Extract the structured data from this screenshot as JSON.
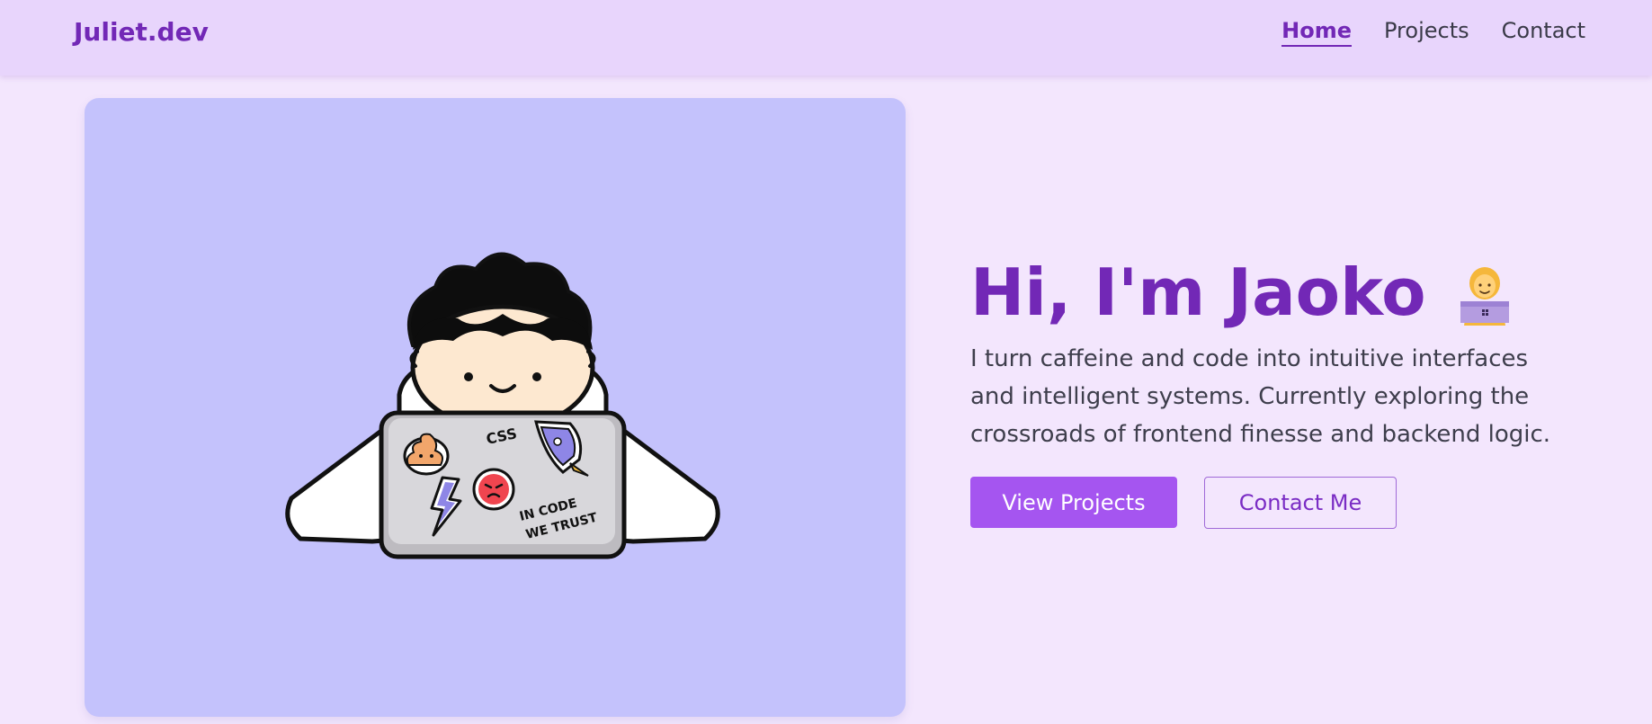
{
  "nav": {
    "brand": "Juliet.dev",
    "links": [
      {
        "label": "Home",
        "active": true
      },
      {
        "label": "Projects",
        "active": false
      },
      {
        "label": "Contact",
        "active": false
      }
    ]
  },
  "hero": {
    "headline": "Hi, I'm Jaoko",
    "headline_emoji": "woman-technologist-icon",
    "intro": "I turn caffeine and code into intuitive interfaces and intelligent systems. Currently exploring the crossroads of frontend finesse and backend logic.",
    "primary_button": "View Projects",
    "secondary_button": "Contact Me"
  },
  "illustration": {
    "stickers": {
      "css": "CSS",
      "motto_line1": "IN CODE",
      "motto_line2": "WE TRUST"
    }
  },
  "colors": {
    "brand": "#7228b6",
    "page_background": "#f3e6fd",
    "navbar_background": "#e8d5fc",
    "card_background": "#c4c2fc",
    "primary_button": "#a555f0"
  }
}
